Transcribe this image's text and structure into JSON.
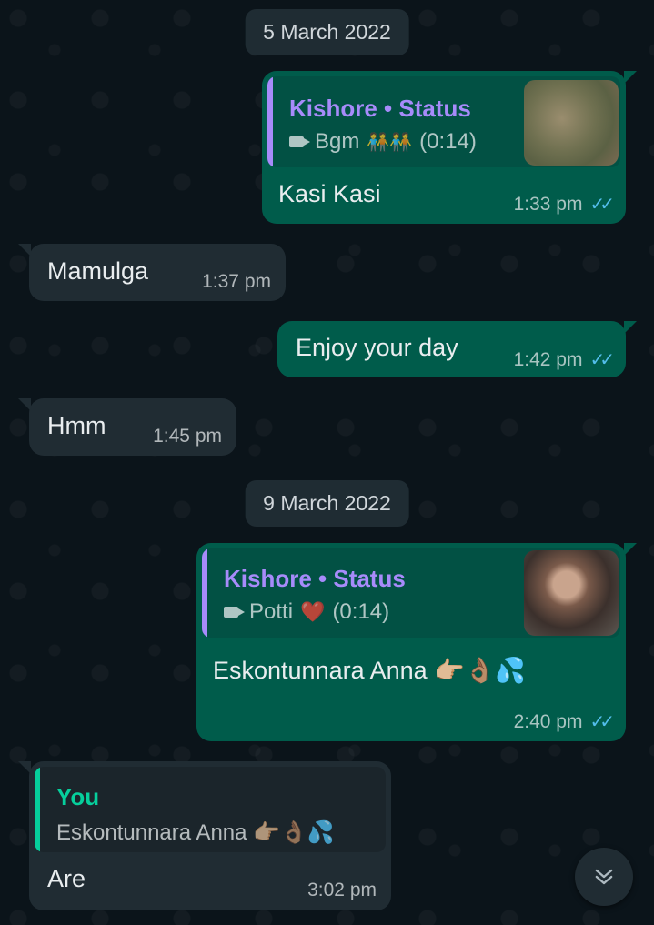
{
  "dates": [
    "5 March 2022",
    "9 March 2022"
  ],
  "messages": [
    {
      "text": "Kasi Kasi",
      "time": "1:33 pm",
      "quote": {
        "title": "Kishore • Status",
        "media_label": "Bgm",
        "emoji": "🧑‍🤝‍🧑🧑‍🤝‍🧑",
        "duration": "(0:14)"
      }
    },
    {
      "text": "Mamulga",
      "time": "1:37 pm"
    },
    {
      "text": "Enjoy your day",
      "time": "1:42 pm"
    },
    {
      "text": "Hmm",
      "time": "1:45 pm"
    },
    {
      "text": "Eskontunnara Anna 👉🏼👌🏽💦",
      "time": "2:40 pm",
      "quote": {
        "title": "Kishore • Status",
        "media_label": "Potti",
        "emoji": "❤️",
        "duration": "(0:14)"
      }
    },
    {
      "text": "Are",
      "time": "3:02 pm",
      "quote": {
        "title": "You",
        "subtitle": "Eskontunnara Anna 👉🏼👌🏽💦"
      }
    }
  ],
  "ticks": "✓✓",
  "icons": {
    "video": "video-icon",
    "scroll_down": "double-chevron-down-icon",
    "read_receipt": "double-check-icon"
  },
  "colors": {
    "background": "#0b141a",
    "outgoing_bubble": "#005c4b",
    "incoming_bubble": "#202c33",
    "status_quote_accent": "#a78bfa",
    "self_quote_accent": "#06cf9c",
    "read_ticks": "#53bdeb"
  }
}
